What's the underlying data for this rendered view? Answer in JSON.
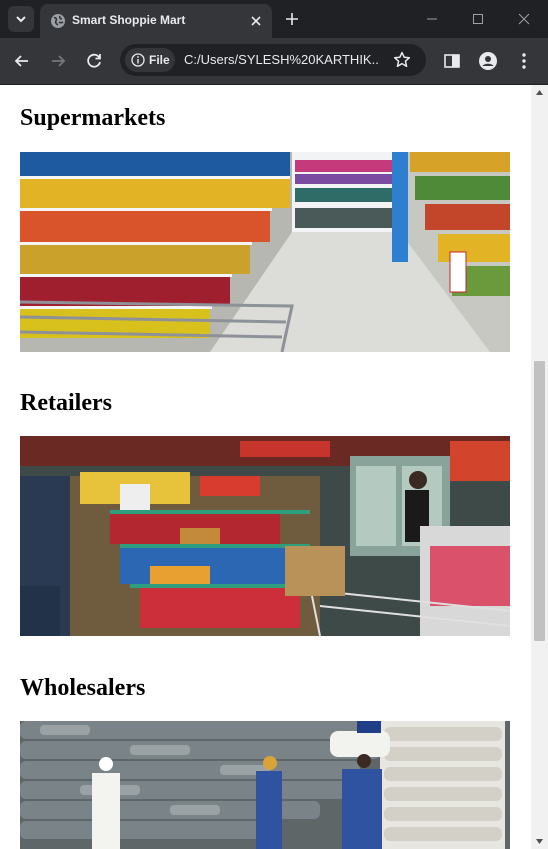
{
  "browser": {
    "tab_title": "Smart Shoppie Mart",
    "security_chip": "File",
    "url": "C:/Users/SYLESH%20KARTHIK...",
    "icons": [
      "tab-search-icon",
      "globe-icon",
      "close-icon",
      "plus-icon",
      "minimize-icon",
      "maximize-icon",
      "window-close-icon",
      "back-arrow-icon",
      "forward-arrow-icon",
      "reload-icon",
      "info-icon",
      "star-icon",
      "side-panel-icon",
      "profile-icon",
      "kebab-menu-icon"
    ]
  },
  "page": {
    "sections": [
      {
        "heading": "Supermarkets",
        "image": "supermarket-aisle-photo"
      },
      {
        "heading": "Retailers",
        "image": "retail-store-photo"
      },
      {
        "heading": "Wholesalers",
        "image": "wholesale-warehouse-photo"
      }
    ]
  },
  "colors": {
    "chrome_dark": "#202124",
    "chrome_mid": "#35363a",
    "chrome_text": "#e8eaed",
    "page_bg": "#ffffff",
    "scrollbar_track": "#f1f1f1",
    "scrollbar_thumb": "#c1c1c1"
  }
}
